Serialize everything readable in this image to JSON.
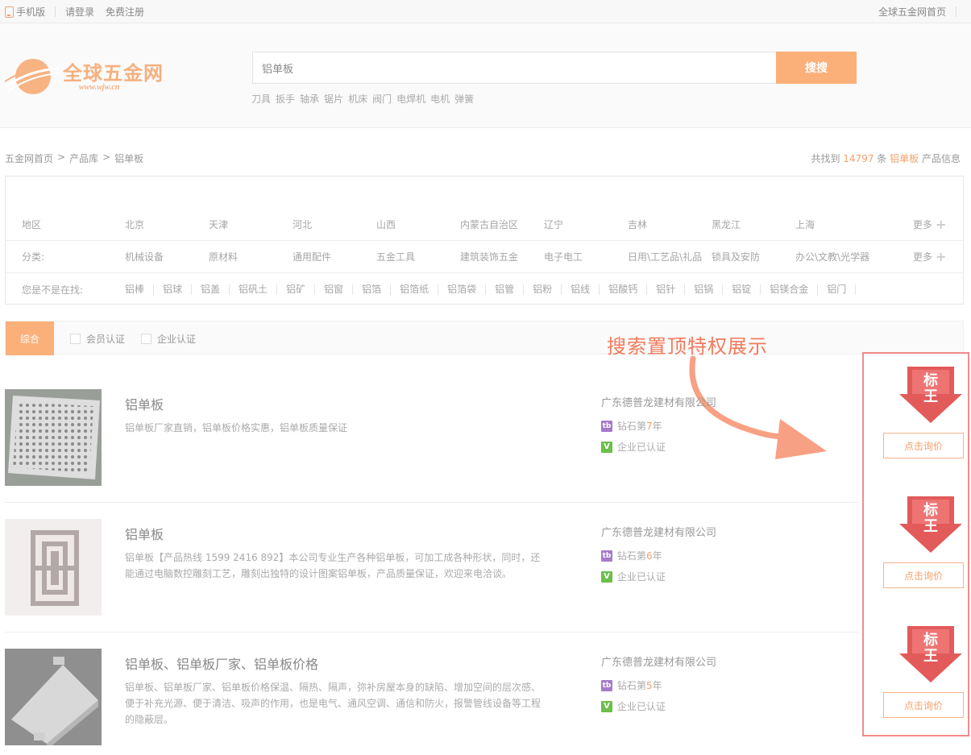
{
  "topbar": {
    "mobile": "手机版",
    "login": "请登录",
    "register": "免费注册",
    "home": "全球五金网首页"
  },
  "logo": {
    "name": "全球五金网",
    "url": "www.wjw.cn"
  },
  "search": {
    "value": "铝单板",
    "button": "搜搜",
    "hotwords": [
      "刀具",
      "扳手",
      "轴承",
      "锯片",
      "机床",
      "阀门",
      "电焊机",
      "电机",
      "弹簧"
    ]
  },
  "breadcrumb": {
    "items": [
      "五金网首页",
      "产品库",
      "铝单板"
    ],
    "sep": ">"
  },
  "result": {
    "prefix": "共找到",
    "count": "14797",
    "unit": "条",
    "keyword": "铝单板",
    "suffix": "产品信息"
  },
  "filter": {
    "region": {
      "label": "地区",
      "options": [
        "北京",
        "天津",
        "河北",
        "山西",
        "内蒙古自治区",
        "辽宁",
        "吉林",
        "黑龙江",
        "上海"
      ],
      "more": "更多"
    },
    "category": {
      "label": "分类:",
      "options": [
        "机械设备",
        "原材料",
        "通用配件",
        "五金工具",
        "建筑装饰五金",
        "电子电工",
        "日用\\工艺品\\礼品",
        "锁具及安防",
        "办公\\文教\\光学器"
      ],
      "more": "更多"
    },
    "suggest": {
      "label": "您是不是在找:",
      "options": [
        "铝棒",
        "铝球",
        "铝盖",
        "铝矾土",
        "铝矿",
        "铝窗",
        "铝箔",
        "铝箔纸",
        "铝箔袋",
        "铝管",
        "铝粉",
        "铝线",
        "铝酸钙",
        "铝针",
        "铝锅",
        "铝锭",
        "铝镁合金",
        "铝门"
      ]
    }
  },
  "sortbar": {
    "active": "综合",
    "member_cert": "会员认证",
    "company_cert": "企业认证"
  },
  "promo": "搜索置顶特权展示",
  "products": [
    {
      "title": "铝单板",
      "desc": "铝单板厂家直销，铝单板价格实惠，铝单板质量保证",
      "company": "广东德普龙建材有限公司",
      "rank_prefix": "钻石第",
      "years": "7",
      "rank_suffix": "年",
      "cert": "企业已认证",
      "badge": "标王",
      "inquiry": "点击询价"
    },
    {
      "title": "铝单板",
      "desc": "铝单板【产品热线 1599 2416 892】本公司专业生产各种铝单板，可加工成各种形状，同时，还能通过电脑数控雕刻工艺，雕刻出独特的设计图案铝单板，产品质量保证，欢迎来电洽谈。",
      "company": "广东德普龙建材有限公司",
      "rank_prefix": "钻石第",
      "years": "6",
      "rank_suffix": "年",
      "cert": "企业已认证",
      "badge": "标王",
      "inquiry": "点击询价"
    },
    {
      "title": "铝单板、铝单板厂家、铝单板价格",
      "desc": "铝单板、铝单板厂家、铝单板价格保温、隔热、隔声，弥补房屋本身的缺陷、增加空间的层次感、便于补充光源、便于清洁、吸声的作用，也是电气、通风空调、通信和防火，报警管线设备等工程的隐蔽层。",
      "company": "广东德普龙建材有限公司",
      "rank_prefix": "钻石第",
      "years": "5",
      "rank_suffix": "年",
      "cert": "企业已认证",
      "badge": "标王",
      "inquiry": "点击询价"
    }
  ],
  "colors": {
    "accent": "#fbb07a",
    "promo": "#f47a5b",
    "highlight_box": "#f28b8b",
    "badge": "#e25a5a"
  }
}
